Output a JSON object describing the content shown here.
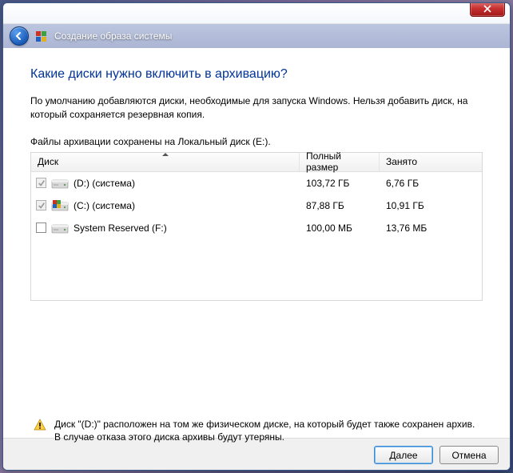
{
  "window": {
    "nav_title": "Создание образа системы"
  },
  "main": {
    "heading": "Какие диски нужно включить в архивацию?",
    "description": "По умолчанию добавляются диски, необходимые для запуска Windows. Нельзя добавить диск, на который сохраняется резервная копия.",
    "save_location": "Файлы архивации сохранены на Локальный диск (E:)."
  },
  "table": {
    "headers": {
      "disk": "Диск",
      "full_size": "Полный размер",
      "used": "Занято"
    },
    "rows": [
      {
        "checked": true,
        "disabled": true,
        "has_flag": false,
        "label": "(D:) (система)",
        "size": "103,72 ГБ",
        "used": "6,76 ГБ"
      },
      {
        "checked": true,
        "disabled": true,
        "has_flag": true,
        "label": "(C:) (система)",
        "size": "87,88 ГБ",
        "used": "10,91 ГБ"
      },
      {
        "checked": false,
        "disabled": false,
        "has_flag": false,
        "label": "System Reserved (F:)",
        "size": "100,00 МБ",
        "used": "13,76 МБ"
      }
    ]
  },
  "warning": "Диск \"(D:)\" расположен на том же физическом диске, на который будет также сохранен архив. В случае отказа этого диска архивы будут утеряны.",
  "buttons": {
    "next": "Далее",
    "cancel": "Отмена"
  }
}
